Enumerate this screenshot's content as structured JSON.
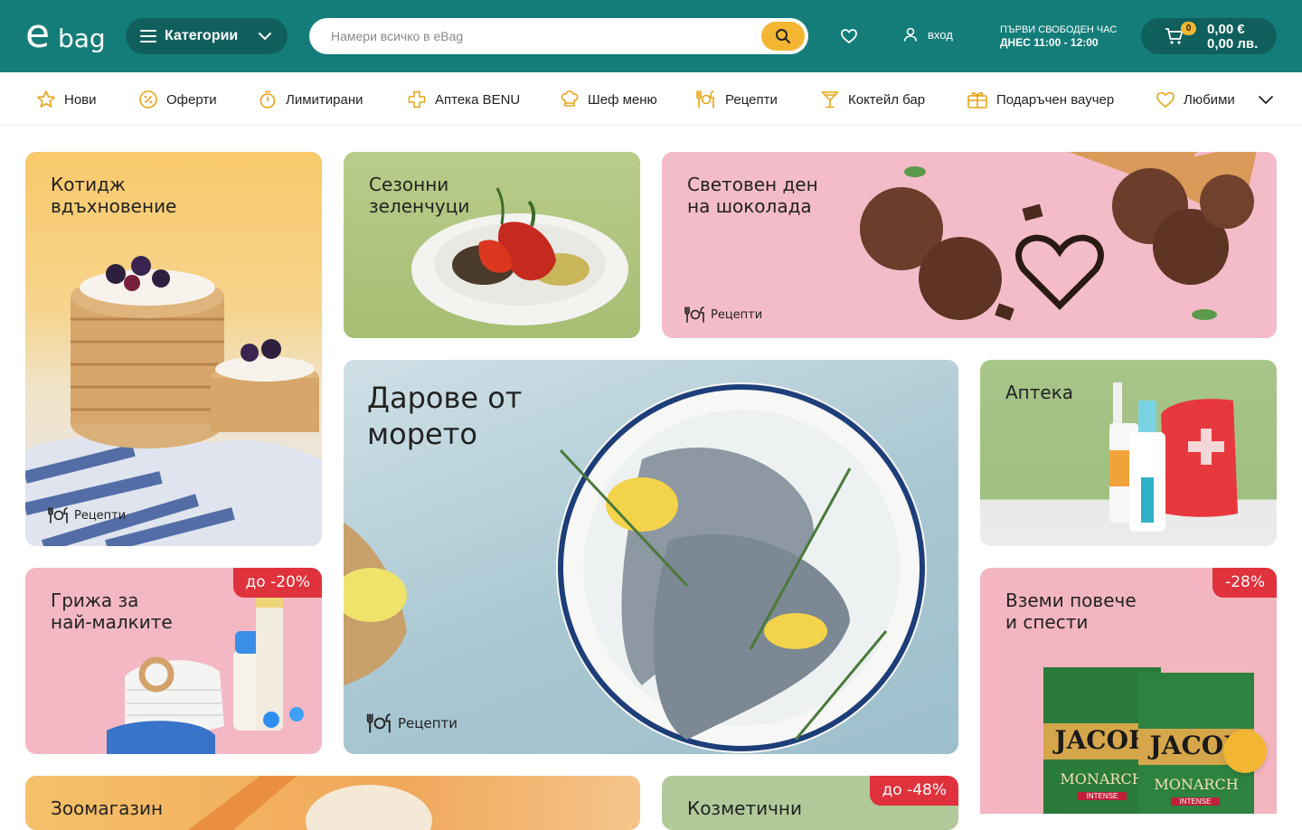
{
  "header": {
    "logo_e": "e",
    "logo_bag": "bag",
    "categories_label": "Категории",
    "search_placeholder": "Намери всичко в eBag",
    "login_label": "вход",
    "slot_line1": "ПЪРВИ СВОБОДЕН ЧАС",
    "slot_line2": "ДНЕС 11:00 - 12:00",
    "cart_count": "0",
    "cart_price_eur": "0,00 €",
    "cart_price_bgn": "0,00 лв."
  },
  "nav": {
    "items": [
      {
        "label": "Нови",
        "icon": "star-icon"
      },
      {
        "label": "Оферти",
        "icon": "percent-icon"
      },
      {
        "label": "Лимитирани",
        "icon": "timer-icon"
      },
      {
        "label": "Аптека BENU",
        "icon": "pharmacy-cross-icon"
      },
      {
        "label": "Шеф меню",
        "icon": "chef-hat-icon"
      },
      {
        "label": "Рецепти",
        "icon": "recipes-icon"
      },
      {
        "label": "Коктейл бар",
        "icon": "cocktail-icon"
      },
      {
        "label": "Подаръчен ваучер",
        "icon": "gift-icon"
      },
      {
        "label": "Любими",
        "icon": "heart-icon"
      }
    ]
  },
  "tiles": {
    "cottage": {
      "title": "Котидж\nвдъхновение",
      "tag": "Рецепти"
    },
    "vegetables": {
      "title": "Сезонни\nзеленчуци"
    },
    "chocolate": {
      "title": "Световен ден\nна шоколада",
      "tag": "Рецепти"
    },
    "sea": {
      "title": "Дарове от\nморето",
      "tag": "Рецепти"
    },
    "pharmacy": {
      "title": "Аптека"
    },
    "babies": {
      "title": "Грижа за\nнай-малките",
      "badge": "до -20%"
    },
    "save": {
      "title": "Вземи повече\nи спести",
      "badge": "-28%",
      "brand1": "JACOB",
      "brand2": "JACOE",
      "sub": "MONARCH",
      "sub2": "INTENSE"
    },
    "pet": {
      "title": "Зоомагазин"
    },
    "cosmetics": {
      "title": "Козметични",
      "badge": "до -48%"
    }
  },
  "colors": {
    "header_bg": "#147d7a",
    "accent_yellow": "#f2b632",
    "badge_red": "#e0323c"
  }
}
